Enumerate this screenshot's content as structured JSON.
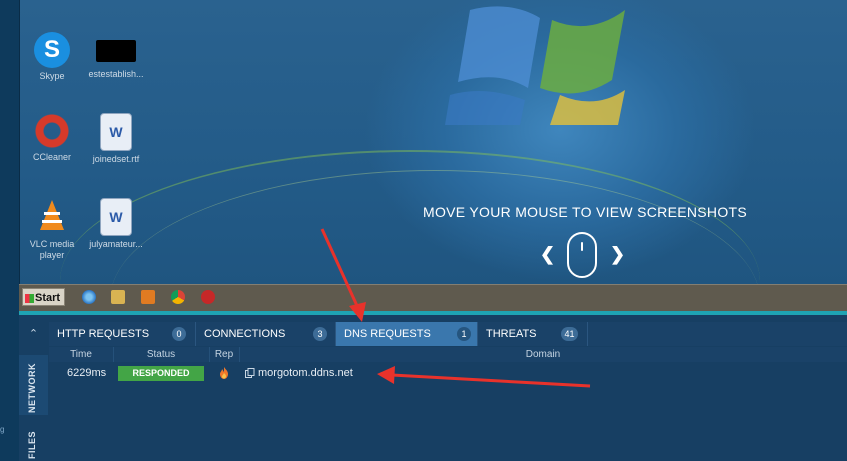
{
  "desktop": {
    "icons": [
      {
        "name": "skype-desktop-icon",
        "label": "Skype"
      },
      {
        "name": "estestablish-desktop-icon",
        "label": "estestablish..."
      },
      {
        "name": "ccleaner-desktop-icon",
        "label": "CCleaner"
      },
      {
        "name": "joinedset-desktop-icon",
        "label": "joinedset.rtf"
      },
      {
        "name": "vlc-desktop-icon",
        "label": "VLC media player"
      },
      {
        "name": "julyamateur-desktop-icon",
        "label": "julyamateur..."
      }
    ],
    "overlay_message": "MOVE YOUR MOUSE TO VIEW SCREENSHOTS"
  },
  "taskbar": {
    "start_label": "Start",
    "icons": [
      "ie-icon",
      "folder-icon",
      "media-player-icon",
      "chrome-icon",
      "opera-icon"
    ]
  },
  "side": {
    "collapse_icon": "chevron-up-icon",
    "tabs": [
      "NETWORK",
      "FILES"
    ]
  },
  "tabs": [
    {
      "label": "HTTP REQUESTS",
      "count": "0"
    },
    {
      "label": "CONNECTIONS",
      "count": "3"
    },
    {
      "label": "DNS REQUESTS",
      "count": "1",
      "active": true
    },
    {
      "label": "THREATS",
      "count": "41"
    }
  ],
  "table": {
    "columns": [
      "Time",
      "Status",
      "Rep",
      "Domain"
    ],
    "rows": [
      {
        "time": "6229ms",
        "status": "RESPONDED",
        "rep_icon": "flame-icon",
        "domain": "morgotom.ddns.net"
      }
    ]
  },
  "colors": {
    "accent_teal": "#1fa3b3",
    "active_tab": "#3a77ad",
    "status_green": "#43a546",
    "annotation_red": "#e8322b"
  }
}
